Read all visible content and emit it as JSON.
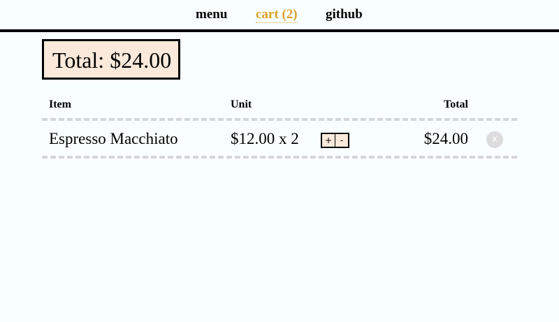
{
  "nav": {
    "menu_label": "menu",
    "cart_label": "cart (2)",
    "github_label": "github",
    "active_color": "#daa12a"
  },
  "summary": {
    "total_text": "Total: $24.00"
  },
  "table": {
    "headers": {
      "item": "Item",
      "unit": "Unit",
      "total": "Total"
    },
    "rows": [
      {
        "name": "Espresso Macchiato",
        "unit_text": "$12.00 x 2",
        "increment_label": "+",
        "decrement_label": "-",
        "total": "$24.00",
        "remove_label": "x"
      }
    ]
  },
  "colors": {
    "background": "#f9fffe",
    "total_box_bg": "#fbeadb",
    "divider": "#d6d6d6",
    "remove_button": "#dcdcdc"
  }
}
